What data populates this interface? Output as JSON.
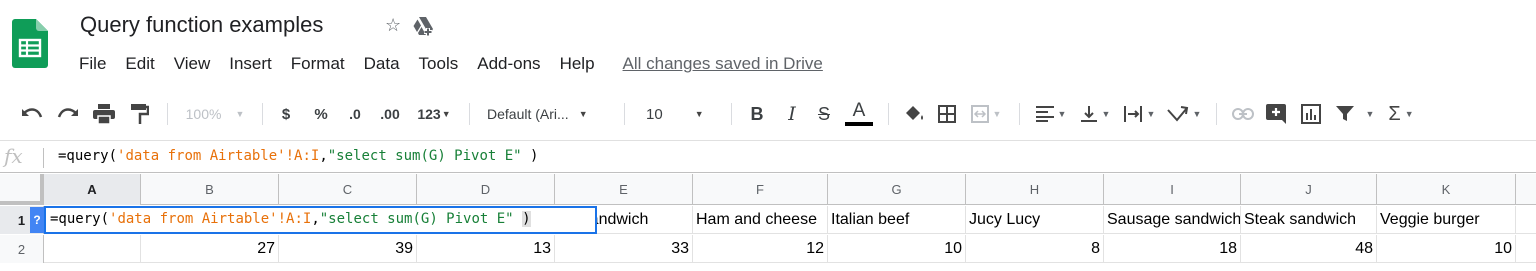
{
  "doc": {
    "title": "Query function examples",
    "saved_status": "All changes saved in Drive"
  },
  "menu": [
    "File",
    "Edit",
    "View",
    "Insert",
    "Format",
    "Data",
    "Tools",
    "Add-ons",
    "Help"
  ],
  "toolbar": {
    "zoom": "100%",
    "currency": "$",
    "percent": "%",
    "decrease_decimal": ".0",
    "increase_decimal": ".00",
    "more_formats": "123",
    "font_family": "Default (Ari...",
    "font_size": "10",
    "bold": "B",
    "italic": "I",
    "strike": "S",
    "text_color": "A"
  },
  "formula_bar": {
    "fx_label": "fx",
    "prefix": "=query(",
    "range_string": "'data from Airtable'!A:I",
    "comma": ",",
    "query_string": "\"select sum(G) Pivot E\"",
    "suffix": " )"
  },
  "grid": {
    "columns": [
      "A",
      "B",
      "C",
      "D",
      "E",
      "F",
      "G",
      "H",
      "I",
      "J",
      "K"
    ],
    "rows": [
      "1",
      "2"
    ],
    "row1": [
      "",
      "",
      "",
      "",
      "Veggie sandwich",
      "Ham and cheese",
      "Italian beef",
      "Jucy Lucy",
      "Sausage sandwich",
      "Steak sandwich",
      "Veggie burger"
    ],
    "row1_visible_E": "ver sandwich",
    "row2": [
      "",
      "27",
      "39",
      "13",
      "33",
      "12",
      "10",
      "8",
      "18",
      "48",
      "10"
    ]
  },
  "editor": {
    "help": "?",
    "prefix": "=query(",
    "range_string": "'data from Airtable'!A:I",
    "comma": ",",
    "query_string": "\"select sum(G) Pivot E\"",
    "space": " ",
    "close_paren": ")"
  },
  "colors": {
    "sheets_green": "#0f9d58",
    "selection_blue": "#1a73e8",
    "string_orange": "#e8710a"
  }
}
